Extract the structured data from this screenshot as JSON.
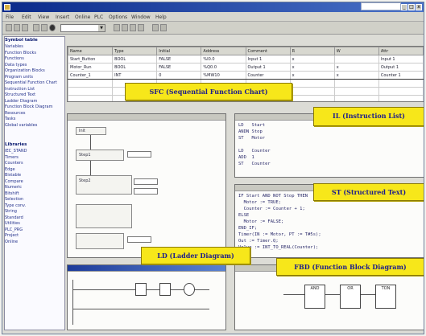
{
  "window": {
    "title": "",
    "controls": [
      "_",
      "□",
      "x"
    ]
  },
  "menubar": {
    "items": [
      "File",
      "Edit",
      "View",
      "Insert",
      "Online",
      "PLC",
      "Options",
      "Window",
      "Help"
    ]
  },
  "toolbar": {
    "combo_value": ""
  },
  "sidebar": {
    "header1": "Symbol table",
    "items1": [
      "Variables",
      "Function Blocks",
      "Functions",
      "Data types",
      "Organization Blocks",
      "Program units",
      "Sequential Function Chart",
      "Instruction List",
      "Structured Text",
      "Ladder Diagram",
      "Function Block Diagram",
      "Resources",
      "Tasks",
      "Global variables"
    ],
    "header2": "Libraries",
    "items2": [
      "IEC_STAND",
      "Timers",
      "Counters",
      "Edge",
      "Bistable",
      "Compare",
      "Numeric",
      "Bitshift",
      "Selection",
      "Type conv.",
      "String",
      "Standard",
      "Utilities",
      "PLC_PRG",
      "Project",
      "Online"
    ]
  },
  "variables_table": {
    "columns": [
      "Name",
      "Type",
      "Initial",
      "Address",
      "Comment",
      "R",
      "W",
      "Attr"
    ],
    "rows": [
      [
        "Start_Button",
        "BOOL",
        "FALSE",
        "%I0.0",
        "Input 1",
        "x",
        "",
        "Input 1"
      ],
      [
        "Motor_Run",
        "BOOL",
        "FALSE",
        "%Q0.0",
        "Output 1",
        "x",
        "x",
        "Output 1"
      ],
      [
        "Counter_1",
        "INT",
        "0",
        "%MW10",
        "Counter",
        "x",
        "x",
        "Counter 1"
      ]
    ]
  },
  "panes": {
    "il_code": [
      "LD   Start",
      "ANDN Stop",
      "ST   Motor",
      "",
      "LD   Counter",
      "ADD  1",
      "ST   Counter"
    ],
    "st_code": [
      "IF Start AND NOT Stop THEN",
      "  Motor := TRUE;",
      "  Counter := Counter + 1;",
      "ELSE",
      "  Motor := FALSE;",
      "END_IF;",
      "Timer(IN := Motor, PT := T#5s);",
      "Out := Timer.Q;",
      "Value := INT_TO_REAL(Counter);"
    ],
    "sfc_labels": [
      "Init",
      "Step1",
      "Step2"
    ],
    "fbd_blocks": [
      "AND",
      "OR",
      "TON"
    ]
  },
  "callouts": {
    "sfc": "SFC (Sequential Function Chart)",
    "il": "IL (Instruction List)",
    "st": "ST (Structured Text)",
    "ld": "LD (Ladder Diagram)",
    "fbd": "FBD (Function Block Diagram)"
  }
}
